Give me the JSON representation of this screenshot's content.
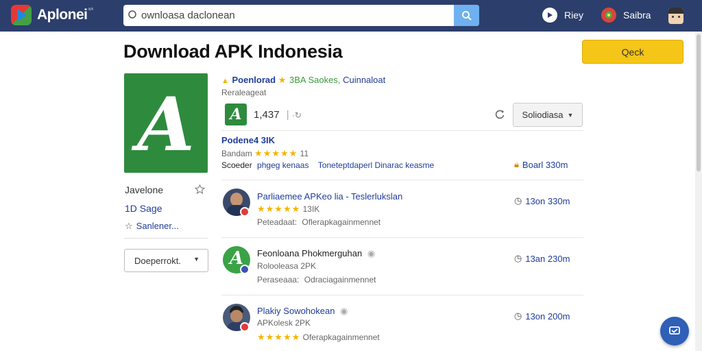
{
  "header": {
    "brand": "Aplonei",
    "brand_sup": "ᵃᵖᵏ",
    "search_value": "ownloasa daclonean",
    "nav": [
      {
        "label": "Riey",
        "icon": "play-icon"
      },
      {
        "label": "Saibra",
        "icon": "globe-icon"
      },
      {
        "label": "",
        "icon": "user-avatar"
      }
    ]
  },
  "page": {
    "title": "Download APK Indonesia",
    "cta_label": "Qeck",
    "app_icon_letter": "A"
  },
  "sidebar": {
    "item1": "Javelone",
    "item2": "1D Sage",
    "item3": "Sanlener...",
    "select_label": "Doeperrokt."
  },
  "summary": {
    "line1_a": "Poenlorad",
    "line1_b": "3BA Saokes,",
    "line1_c": "Cuinnaloat",
    "line2": "Reraleageat",
    "count": "1,437",
    "mini_letter": "A",
    "dropdown_label": "Soliodiasa"
  },
  "featured": {
    "title": "Podene4 3IK",
    "rating_label": "Bandam",
    "rating_value": "11",
    "line_prefix": "Scoeder",
    "line_a": "phgeg kenaas",
    "line_b": "Toneteptdaperl Dinarac keasme",
    "time": "Boarl 330m"
  },
  "items": [
    {
      "title": "Parliaemee APKeo lia - Teslerlukslan",
      "sub": "13IK",
      "desc_label": "Peteadaat:",
      "desc": "Oflerapkagainmennet",
      "time": "13on 330m"
    },
    {
      "title": "Feonloana Phokmerguhan",
      "sub": "Rolooleasa 2PK",
      "desc_label": "Peraseaaa:",
      "desc": "Odraciagainmennet",
      "time": "13an 230m"
    },
    {
      "title": "Plakiy Sowohokean",
      "sub": "APKolesk 2PK",
      "desc_label": "",
      "desc": "Oferapkagainmennet",
      "time": "13on 200m"
    }
  ],
  "colors": {
    "topbar": "#2c3e6b",
    "accent_blue": "#1f3c99",
    "cta": "#f5c518",
    "app_green": "#2e8b3e",
    "star": "#f5b400"
  }
}
